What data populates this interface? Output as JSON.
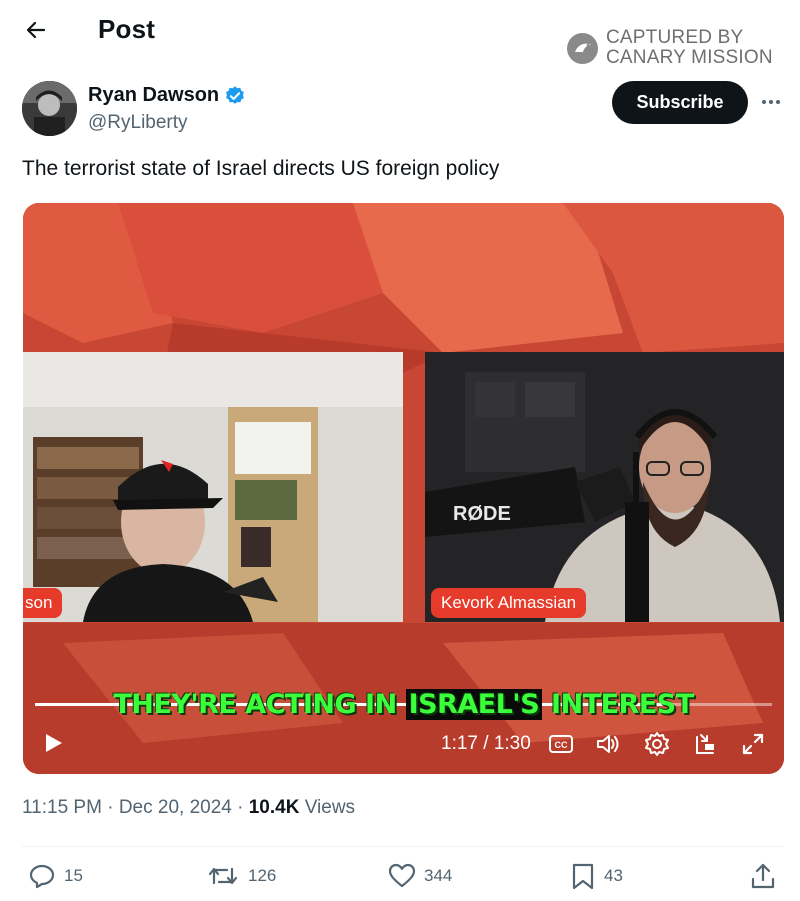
{
  "header": {
    "title": "Post"
  },
  "watermark": {
    "line1": "CAPTURED BY",
    "line2": "CANARY MISSION"
  },
  "author": {
    "name": "Ryan Dawson",
    "handle": "@RyLiberty"
  },
  "subscribe_label": "Subscribe",
  "post": {
    "text": "The terrorist state of Israel directs US foreign policy"
  },
  "video": {
    "left_name_tag": "son",
    "right_name_tag": "Kevork Almassian",
    "mic_brand": "RØDE",
    "caption_before": "THEY'RE ACTING IN ",
    "caption_highlight": "ISRAEL'S",
    "caption_after": " INTEREST",
    "time": "1:17 / 1:30",
    "progress": 0.855,
    "cc_label": "CC"
  },
  "meta": {
    "time": "11:15 PM",
    "date": "Dec 20, 2024",
    "views": "10.4K",
    "views_label": "Views",
    "sep": "·"
  },
  "actions": {
    "replies": "15",
    "reposts": "126",
    "likes": "344",
    "bookmarks": "43"
  },
  "colors": {
    "accent": "#1d9bf0",
    "text": "#0f1419",
    "muted": "#536471",
    "caption_green": "#3cff3c",
    "name_tag_red": "#e63b2a"
  }
}
